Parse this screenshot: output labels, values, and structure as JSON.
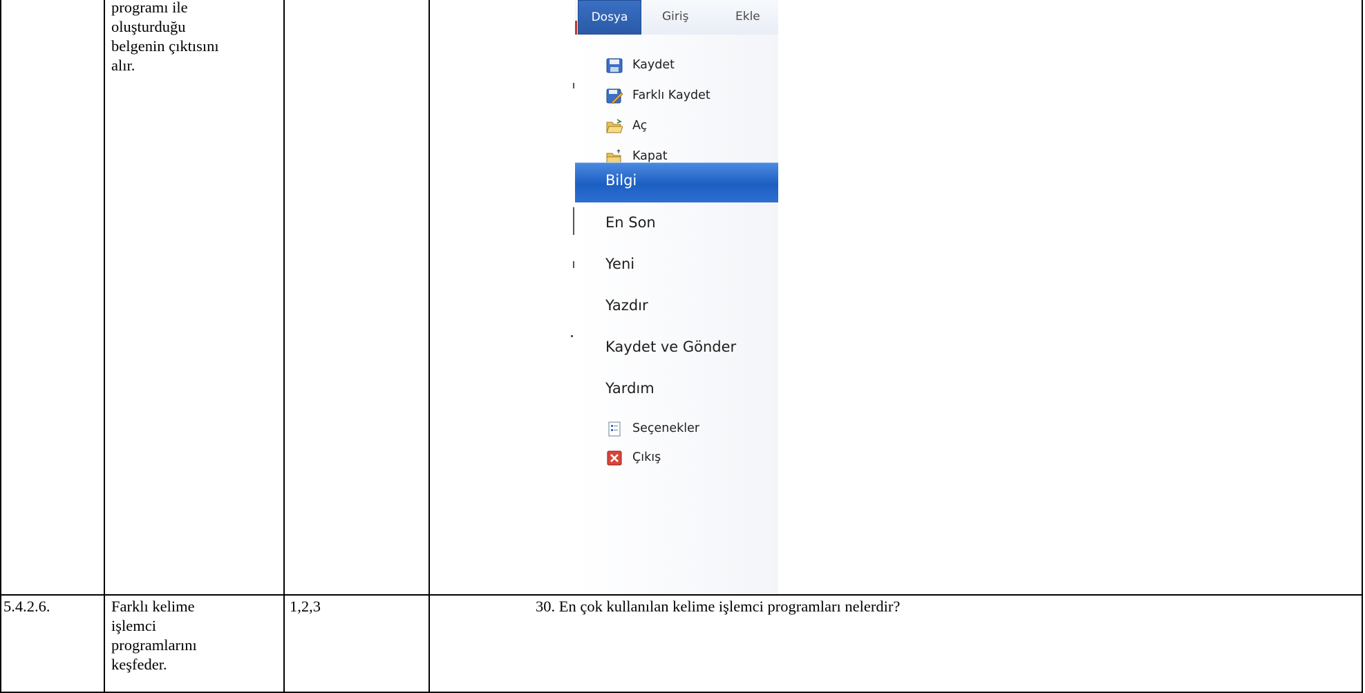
{
  "row1": {
    "objective_lines": [
      "programı ile",
      "oluşturduğu",
      "belgenin çıktısını",
      "alır."
    ]
  },
  "menu": {
    "tabs": [
      "Dosya",
      "Giriş",
      "Ekle"
    ],
    "items": {
      "save": "Kaydet",
      "save_as": "Farklı Kaydet",
      "open": "Aç",
      "close": "Kapat",
      "info": "Bilgi",
      "recent": "En Son",
      "new": "Yeni",
      "print": "Yazdır",
      "save_send": "Kaydet ve Gönder",
      "help": "Yardım",
      "options": "Seçenekler",
      "exit": "Çıkış"
    }
  },
  "row2": {
    "code": "5.4.2.6.",
    "objective_lines": [
      "Farklı kelime",
      "işlemci",
      "programlarını",
      "keşfeder."
    ],
    "levels": "1,2,3",
    "question": "30. En çok kullanılan kelime işlemci programları nelerdir?"
  }
}
